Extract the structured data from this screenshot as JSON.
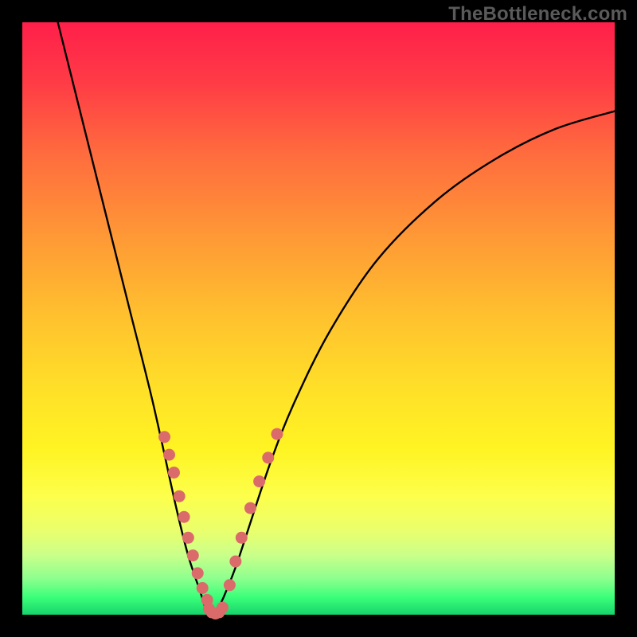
{
  "watermark": "TheBottleneck.com",
  "colors": {
    "frame": "#000000",
    "curve": "#000000",
    "dot": "#db6b6b"
  },
  "chart_data": {
    "type": "line",
    "title": "",
    "xlabel": "",
    "ylabel": "",
    "xlim": [
      0,
      100
    ],
    "ylim": [
      0,
      100
    ],
    "series": [
      {
        "name": "bottleneck-curve",
        "x": [
          6,
          10,
          14,
          18,
          22,
          26,
          28,
          30,
          31,
          32,
          33,
          34,
          36,
          38,
          42,
          46,
          52,
          60,
          70,
          80,
          90,
          100
        ],
        "y": [
          100,
          84,
          68,
          52,
          36,
          18,
          10,
          4,
          1,
          0,
          1,
          3,
          8,
          14,
          26,
          36,
          48,
          60,
          70,
          77,
          82,
          85
        ]
      }
    ],
    "marker_clusters": [
      {
        "name": "left-descent-markers",
        "points": [
          {
            "x": 24.0,
            "y": 30.0
          },
          {
            "x": 24.8,
            "y": 27.0
          },
          {
            "x": 25.6,
            "y": 24.0
          },
          {
            "x": 26.5,
            "y": 20.0
          },
          {
            "x": 27.3,
            "y": 16.5
          },
          {
            "x": 28.0,
            "y": 13.0
          },
          {
            "x": 28.8,
            "y": 10.0
          },
          {
            "x": 29.6,
            "y": 7.0
          },
          {
            "x": 30.4,
            "y": 4.5
          },
          {
            "x": 31.2,
            "y": 2.5
          }
        ]
      },
      {
        "name": "valley-bottom-markers",
        "points": [
          {
            "x": 31.5,
            "y": 1.0
          },
          {
            "x": 32.0,
            "y": 0.4
          },
          {
            "x": 32.6,
            "y": 0.2
          },
          {
            "x": 33.2,
            "y": 0.4
          },
          {
            "x": 33.8,
            "y": 1.2
          }
        ]
      },
      {
        "name": "right-ascent-markers",
        "points": [
          {
            "x": 35.0,
            "y": 5.0
          },
          {
            "x": 36.0,
            "y": 9.0
          },
          {
            "x": 37.0,
            "y": 13.0
          },
          {
            "x": 38.5,
            "y": 18.0
          },
          {
            "x": 40.0,
            "y": 22.5
          },
          {
            "x": 41.5,
            "y": 26.5
          },
          {
            "x": 43.0,
            "y": 30.5
          }
        ]
      }
    ]
  }
}
